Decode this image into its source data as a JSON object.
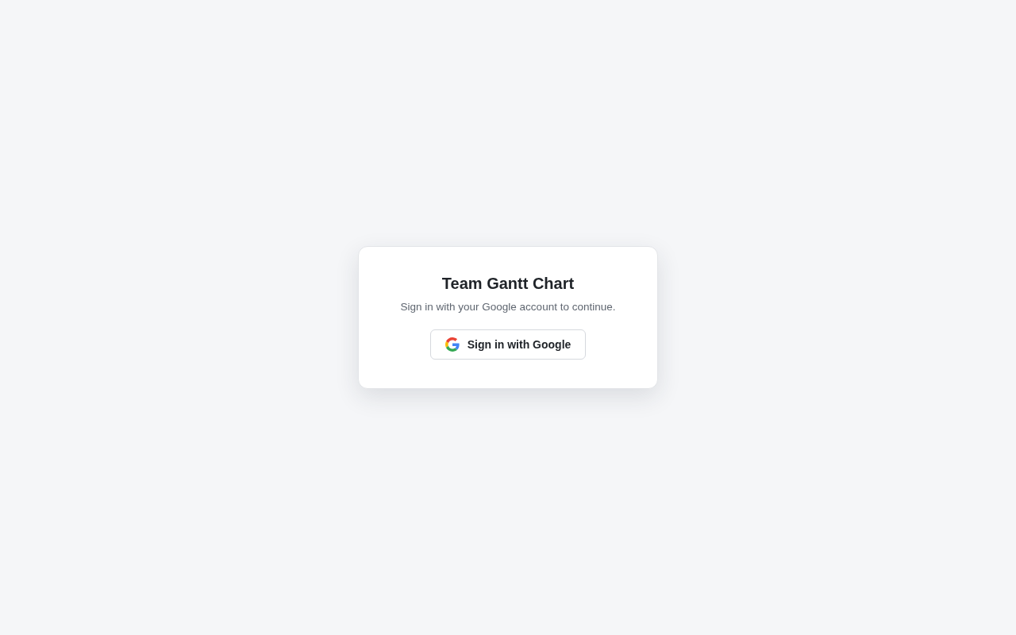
{
  "card": {
    "title": "Team Gantt Chart",
    "subtitle": "Sign in with your Google account to continue.",
    "button": {
      "label": "Sign in with Google"
    }
  }
}
